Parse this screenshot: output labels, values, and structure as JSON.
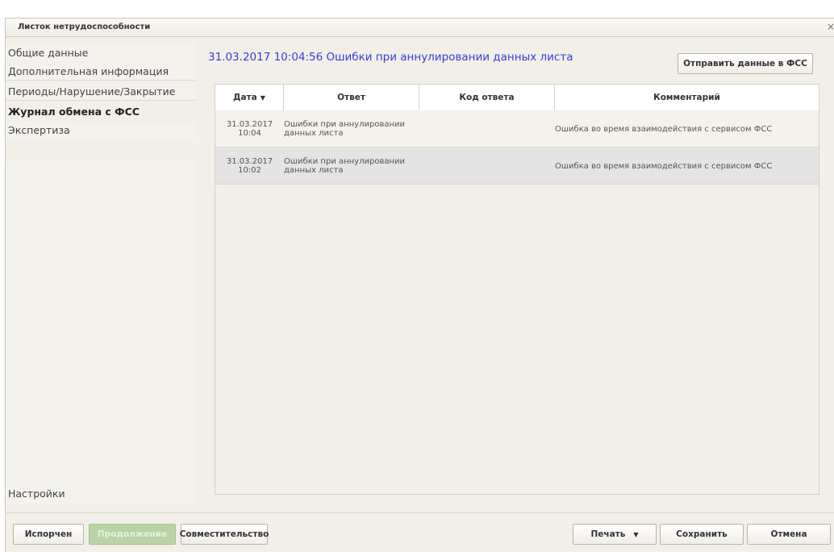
{
  "window": {
    "title": "Листок нетрудоспособности",
    "close_glyph": "×"
  },
  "sidebar": {
    "items": [
      {
        "label": "Общие данные"
      },
      {
        "label": "Дополнительная информация"
      },
      {
        "label": "Периоды/Нарушение/Закрытие"
      },
      {
        "label": "Журнал обмена с ФСС"
      },
      {
        "label": "Экспертиза"
      }
    ],
    "settings_label": "Настройки"
  },
  "main": {
    "title": "31.03.2017 10:04:56 Ошибки при аннулировании данных листа",
    "send_button": "Отправить данные в ФСС"
  },
  "table": {
    "columns": [
      "Дата",
      "Ответ",
      "Код ответа",
      "Комментарий"
    ],
    "sort_icon": "sort-desc-icon",
    "rows": [
      {
        "date": "31.03.2017",
        "time": "10:04",
        "answer_1": "Ошибки при аннулировании",
        "answer_2": "данных листа",
        "code": "",
        "comment": "Ошибка во время взаимодействия с сервисом ФСС"
      },
      {
        "date": "31.03.2017",
        "time": "10:02",
        "answer_1": "Ошибки при аннулировании",
        "answer_2": "данных листа",
        "code": "",
        "comment": "Ошибка во время взаимодействия с сервисом ФСС"
      }
    ]
  },
  "footer": {
    "spoiled": "Испорчен",
    "continuation": "Продолжение",
    "part_time": "Совместительство",
    "print": "Печать",
    "save": "Сохранить",
    "cancel": "Отмена"
  },
  "colors": {
    "title_blue": "#3a3ae0",
    "window_bg": "#f1efe7",
    "row_alt": "#e4e4e4"
  }
}
